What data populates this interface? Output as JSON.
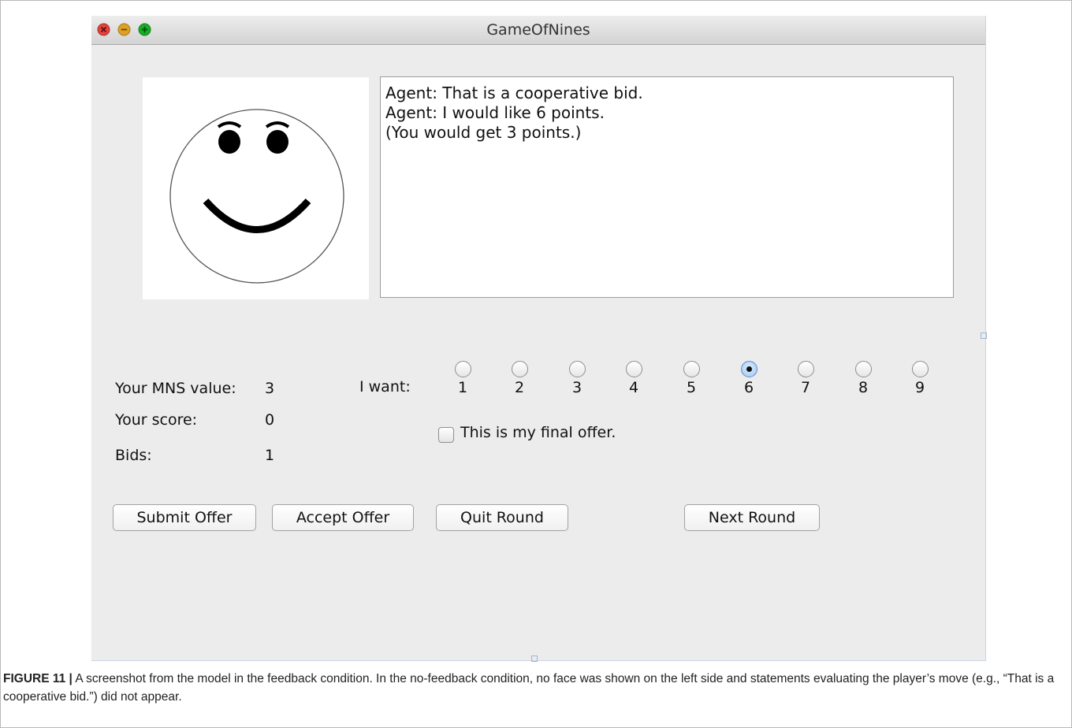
{
  "window": {
    "title": "GameOfNines",
    "close_icon": "close-icon",
    "minimize_icon": "minimize-icon",
    "zoom_icon": "zoom-icon",
    "traffic_colors": {
      "close": "#e0443e",
      "minimize": "#dea123",
      "zoom": "#1aab29"
    }
  },
  "face": {
    "icon": "smiley-face-icon",
    "expression": "smile"
  },
  "messages": [
    "Agent: That is a cooperative bid.",
    "Agent: I would like 6 points.",
    "(You would get 3 points.)"
  ],
  "stats": {
    "mns_label": "Your MNS value:",
    "mns_value": "3",
    "score_label": "Your score:",
    "score_value": "0",
    "bids_label": "Bids:",
    "bids_value": "1"
  },
  "want": {
    "label": "I want:",
    "options": [
      "1",
      "2",
      "3",
      "4",
      "5",
      "6",
      "7",
      "8",
      "9"
    ],
    "selected": "6"
  },
  "final_offer": {
    "label": "This is my final offer.",
    "checked": false
  },
  "buttons": {
    "submit": "Submit Offer",
    "accept": "Accept Offer",
    "quit": "Quit Round",
    "next": "Next Round"
  },
  "caption": {
    "lead": "FIGURE 11 |",
    "text": " A screenshot from the model in the feedback condition. In the no-feedback condition, no face was shown on the left side and statements evaluating the player’s move (e.g., “That is a cooperative bid.”) did not appear."
  },
  "colors": {
    "window_bg": "#ececec",
    "radio_selected": "#9fc6f0"
  }
}
